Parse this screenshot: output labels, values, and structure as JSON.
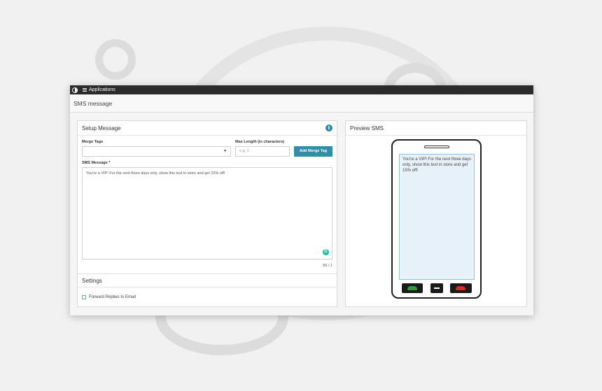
{
  "topbar": {
    "apps_label": "Applications"
  },
  "page": {
    "title": "SMS message"
  },
  "setup": {
    "title": "Setup Message",
    "merge_tags_label": "Merge Tags",
    "merge_tags_value": "",
    "max_length_label": "Max Length (in characters)",
    "max_length_placeholder": "e.g. 2",
    "add_merge_tag_button": "Add Merge Tag",
    "sms_message_label": "SMS Message *",
    "sms_message_value": "You're a VIP! For the next three days only, show this text in store and get 15% off!",
    "char_counter": "56 / 1"
  },
  "settings": {
    "title": "Settings",
    "forward_replies_label": "Forward Replies to Email",
    "forward_replies_checked": false
  },
  "preview": {
    "title": "Preview SMS",
    "screen_text": "You're a VIP! For the next three days only, show this text in store and get 15% off!"
  },
  "colors": {
    "accent": "#2f8ea8",
    "topbar": "#2b2b2b",
    "call_green": "#2e9e3c",
    "end_red": "#d42b2b"
  },
  "icons": [
    "logo-icon",
    "apps-grid-icon",
    "info-icon",
    "chevron-down-icon",
    "grammarly-icon",
    "phone-call-icon",
    "phone-end-icon"
  ]
}
